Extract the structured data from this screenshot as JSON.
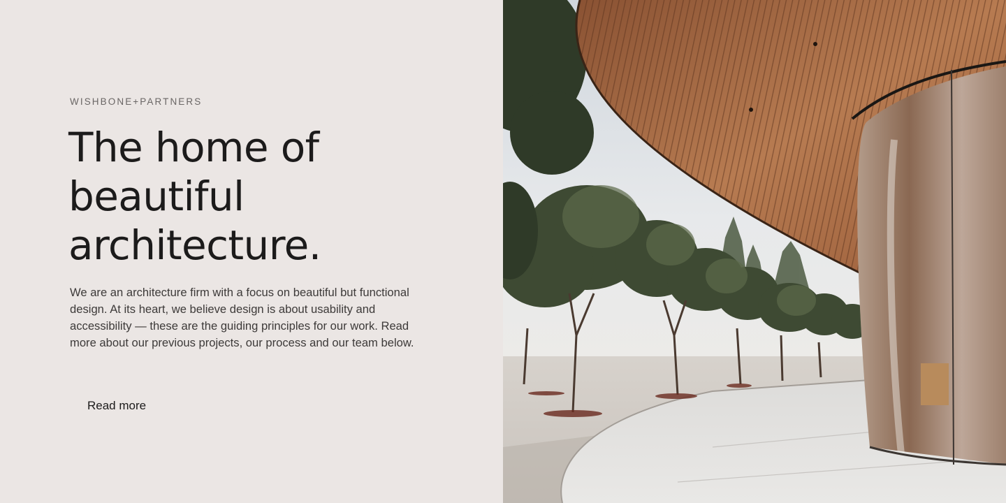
{
  "hero": {
    "brand": "WISHBONE+PARTNERS",
    "headline": [
      "The home of",
      "beautiful",
      "architecture."
    ],
    "body": "We are an architecture firm with a focus on beautiful but functional design. At its heart, we believe design is about usability and accessibility — these are the guiding principles for our work. Read more about our previous projects, our process and our team below.",
    "cta_label": "Read more"
  },
  "image": {
    "subject": "curved glass pavilion with wooden canopy and trees"
  },
  "colors": {
    "background": "#ebe6e4",
    "text": "#1c1b1b",
    "muted": "#6a6665",
    "wood": "#a86a44",
    "sky": "#dfe3e7"
  }
}
